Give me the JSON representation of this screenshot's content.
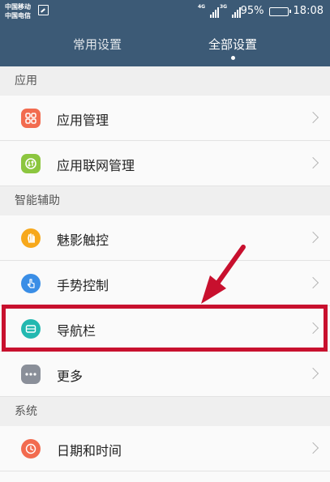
{
  "status_bar": {
    "carrier_1": "中国移动",
    "carrier_2": "中国电信",
    "network_1": "4G",
    "network_2": "3G",
    "battery_percent": "95%",
    "battery_level": 0.95,
    "time": "18:08"
  },
  "tabs": {
    "common": "常用设置",
    "all": "全部设置",
    "selected": "all"
  },
  "sections": [
    {
      "header": "应用",
      "items": [
        {
          "label": "应用管理",
          "icon": "grid-icon",
          "color": "#f26b4f"
        },
        {
          "label": "应用联网管理",
          "icon": "network-sync-icon",
          "color": "#8cc63f"
        }
      ]
    },
    {
      "header": "智能辅助",
      "items": [
        {
          "label": "魅影触控",
          "icon": "hand-touch-icon",
          "color": "#f7a81b"
        },
        {
          "label": "手势控制",
          "icon": "gesture-icon",
          "color": "#3a8ee6"
        },
        {
          "label": "导航栏",
          "icon": "navigation-bar-icon",
          "color": "#22b8b0"
        },
        {
          "label": "更多",
          "icon": "more-dots-icon",
          "color": "#8a8f99"
        }
      ]
    },
    {
      "header": "系统",
      "items": [
        {
          "label": "日期和时间",
          "icon": "clock-icon",
          "color": "#f26b4f"
        }
      ]
    }
  ],
  "annotation": {
    "color": "#c8102e",
    "highlighted_item": "导航栏"
  }
}
